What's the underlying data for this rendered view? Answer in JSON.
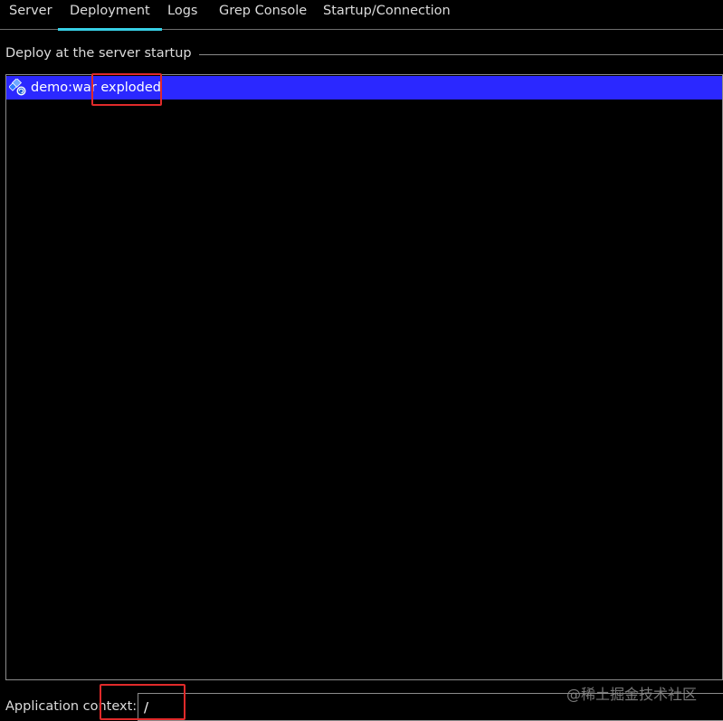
{
  "tabs": [
    {
      "label": "Server"
    },
    {
      "label": "Deployment"
    },
    {
      "label": "Logs"
    },
    {
      "label": "Grep Console"
    },
    {
      "label": "Startup/Connection"
    }
  ],
  "active_tab": "Deployment",
  "deploy_section": {
    "title": "Deploy at the server startup",
    "items": [
      {
        "label": "demo:war exploded",
        "icon": "artifact-war-icon",
        "selected": true
      }
    ]
  },
  "context": {
    "label": "Application context:",
    "value": "/"
  },
  "watermark": "@稀土掘金技术社区",
  "colors": {
    "background": "#000000",
    "selection": "#2b28ff",
    "active_tab_underline": "#37d0e6",
    "annotation": "#e02a2a"
  }
}
